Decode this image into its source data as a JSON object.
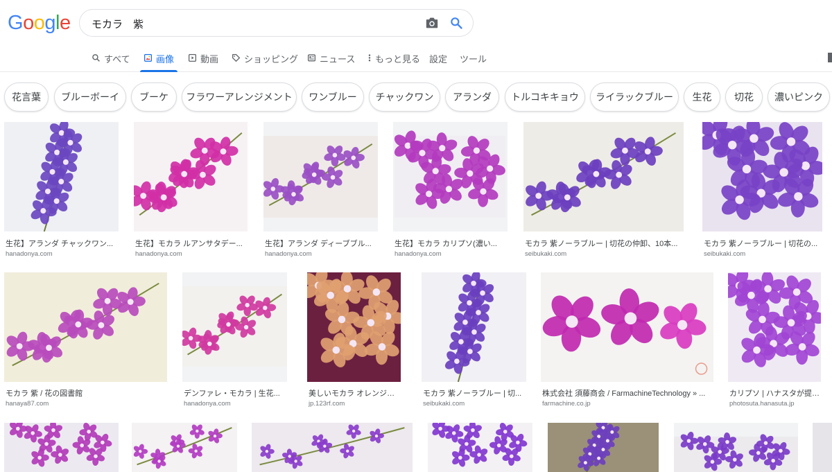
{
  "logo": {
    "letters": [
      "G",
      "o",
      "o",
      "g",
      "l",
      "e"
    ],
    "colors": [
      "#4285f4",
      "#ea4335",
      "#fbbc05",
      "#4285f4",
      "#34a853",
      "#ea4335"
    ]
  },
  "search": {
    "query": "モカラ　紫"
  },
  "tabs": [
    {
      "label": "すべて",
      "icon": "search-icon"
    },
    {
      "label": "画像",
      "icon": "image-icon",
      "active": true
    },
    {
      "label": "動画",
      "icon": "video-icon"
    },
    {
      "label": "ショッピング",
      "icon": "tag-icon"
    },
    {
      "label": "ニュース",
      "icon": "news-icon"
    },
    {
      "label": "もっと見る",
      "icon": "more-icon"
    },
    {
      "label": "設定"
    },
    {
      "label": "ツール"
    }
  ],
  "chips": [
    "花言葉",
    "ブルーボーイ",
    "ブーケ",
    "フラワーアレンジメント",
    "ワンブルー",
    "チャックワン",
    "アランダ",
    "トルコキキョウ",
    "ライラックブルー",
    "生花",
    "切花",
    "濃いピンク"
  ],
  "results": [
    {
      "title": "生花】アランダ チャックワン...",
      "domain": "hanadonya.com"
    },
    {
      "title": "生花】モカラ ルアンサタデー...",
      "domain": "hanadonya.com"
    },
    {
      "title": "生花】アランダ ディーブブル...",
      "domain": "hanadonya.com"
    },
    {
      "title": "生花】モカラ カリプソ(濃い...",
      "domain": "hanadonya.com"
    },
    {
      "title": "モカラ 紫ノーラブルー | 切花の仲卸、10本...",
      "domain": "seibukaki.com"
    },
    {
      "title": "モカラ 紫ノーラブルー | 切花の...",
      "domain": "seibukaki.com"
    },
    {
      "title": "モカラ 紫 / 花の図書館",
      "domain": "hanaya87.com"
    },
    {
      "title": "デンファレ・モカラ | 生花...",
      "domain": "hanadonya.com"
    },
    {
      "title": "美しいモカラ オレンジのク...",
      "domain": "jp.123rf.com"
    },
    {
      "title": "モカラ 紫ノーラブルー | 切...",
      "domain": "seibukaki.com"
    },
    {
      "title": "株式会社 須藤商会 / FarmachineTechnology » ...",
      "domain": "farmachine.co.jp"
    },
    {
      "title": "カリプソ | ハナスタが提供...",
      "domain": "photosuta.hanasuta.jp"
    }
  ],
  "colors": {
    "accent": "#1a73e8",
    "purple": "#7b4bc2",
    "magenta": "#c23ab8"
  }
}
